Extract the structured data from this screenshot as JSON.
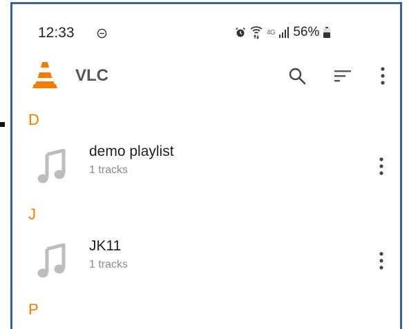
{
  "status_bar": {
    "time": "12:33",
    "network_label": "4G",
    "battery": "56%",
    "icons": [
      "dnd-icon",
      "alarm-icon",
      "wifi-icon",
      "signal-icon",
      "battery-icon"
    ]
  },
  "app_bar": {
    "title": "VLC",
    "icons": [
      "vlc-logo-icon",
      "search-icon",
      "sort-icon",
      "more-vert-icon"
    ]
  },
  "sections": [
    {
      "letter": "D"
    },
    {
      "letter": "J"
    },
    {
      "letter": "P"
    }
  ],
  "playlists": [
    {
      "title": "demo playlist",
      "subtitle": "1 tracks"
    },
    {
      "title": "JK11",
      "subtitle": "1 tracks"
    }
  ],
  "colors": {
    "accent": "#f57c00",
    "frame_border": "#3a5fa0",
    "icon_gray": "#bdbdbd",
    "text_primary": "#1e1e1e",
    "text_secondary": "#8a8a8a"
  }
}
